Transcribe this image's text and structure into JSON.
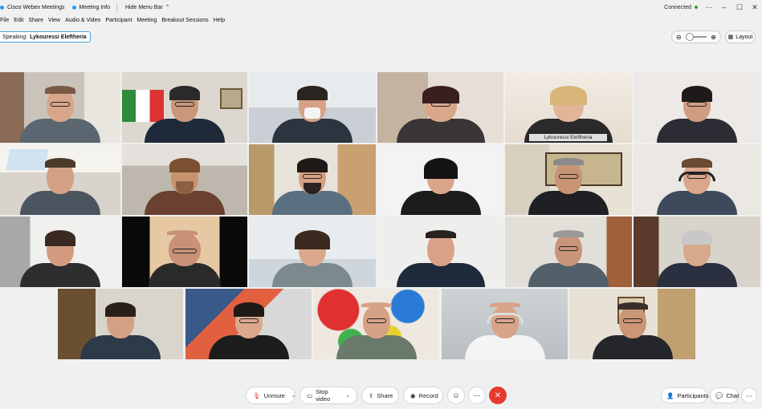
{
  "titlebar": {
    "app_name": "Cisco Webex Meetings",
    "meeting_info": "Meeting Info",
    "hide_menu_bar": "Hide Menu Bar",
    "connected": "Connected"
  },
  "menu": [
    "File",
    "Edit",
    "Share",
    "View",
    "Audio & Video",
    "Participant",
    "Meeting",
    "Breakout Sessions",
    "Help"
  ],
  "speaking": {
    "label": "Speaking:",
    "name": "Lykouressi Eleftheria"
  },
  "layout_button": "Layout",
  "active_speaker_name": "Lykouressi Eleftheria",
  "controls": {
    "unmute": "Unmute",
    "stop_video": "Stop video",
    "share": "Share",
    "record": "Record",
    "participants": "Participants",
    "chat": "Chat"
  },
  "colors": {
    "end_call": "#e53a2e",
    "accent": "#2aa6e0",
    "connected": "#2aa52a"
  }
}
